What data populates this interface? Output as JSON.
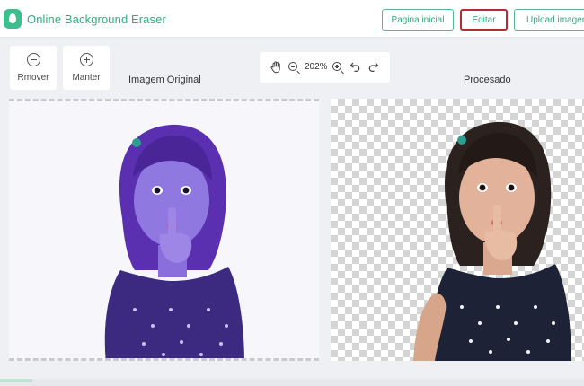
{
  "header": {
    "brand": "Online Background Eraser",
    "nav": {
      "home": "Pagina inicial",
      "edit": "Editar",
      "upload": "Upload imagem"
    },
    "brand_color": "#2fae7e",
    "active_border_color": "#b32b35"
  },
  "tools": {
    "remove_label": "Rmover",
    "keep_label": "Manter"
  },
  "zoom": {
    "value": "202%"
  },
  "panels": {
    "original_caption": "Imagem Original",
    "processed_caption": "Procesado",
    "original_tint": "#7b55d6"
  },
  "icons": [
    "logo-icon",
    "minus-circle-icon",
    "plus-circle-icon",
    "hand-icon",
    "zoom-out-icon",
    "zoom-in-icon",
    "undo-icon",
    "redo-icon"
  ]
}
